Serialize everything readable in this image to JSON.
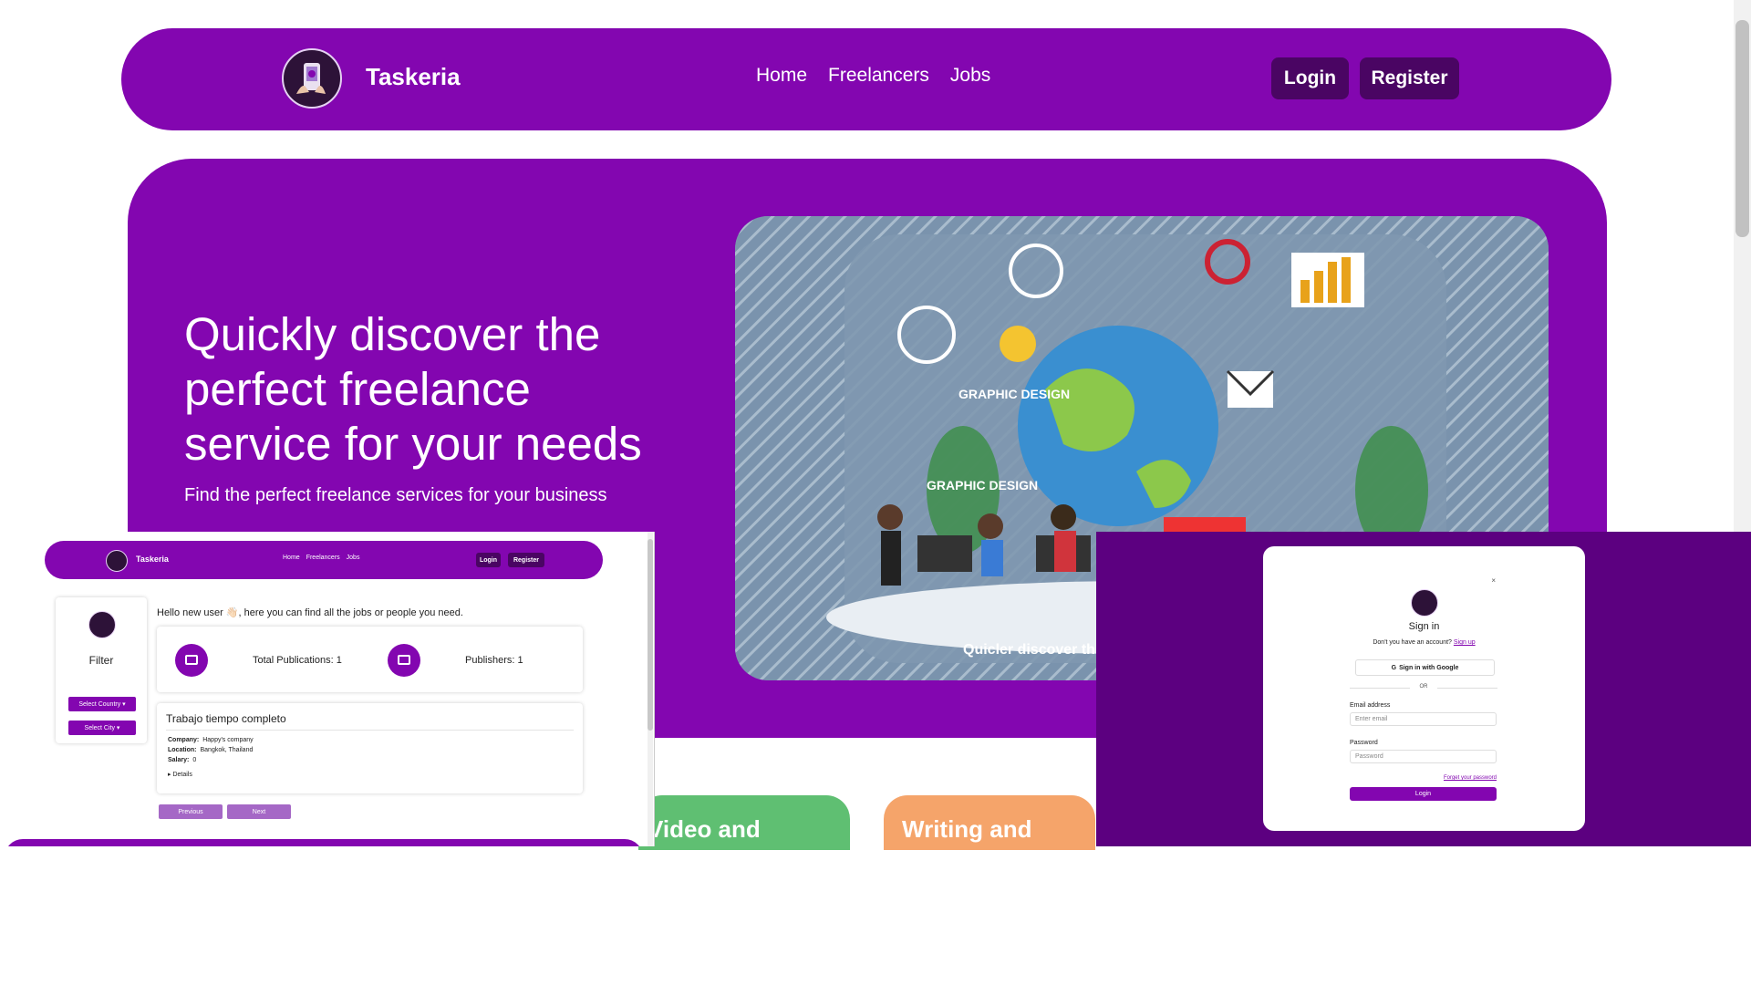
{
  "navbar": {
    "brand": "Taskeria",
    "links": [
      "Home",
      "Freelancers",
      "Jobs"
    ],
    "login": "Login",
    "register": "Register"
  },
  "hero": {
    "title": "Quickly discover the perfect freelance service for your needs",
    "subtitle": "Find the perfect freelance services for your business",
    "image_caption": "Quicler discover th",
    "image_labels": [
      "GRAPHIC DESIGN",
      "GRAPHIC DESIGN"
    ]
  },
  "categories": [
    "Video and",
    "Writing and"
  ],
  "dashboard": {
    "brand": "Taskeria",
    "links": [
      "Home",
      "Freelancers",
      "Jobs"
    ],
    "login": "Login",
    "register": "Register",
    "filter_title": "Filter",
    "select_country": "Select Country ▾",
    "select_city": "Select City ▾",
    "greeting": "Hello new user 👋🏻, here you can find all the jobs or people you need.",
    "total_publications": "Total Publications: 1",
    "publishers": "Publishers: 1",
    "job": {
      "title": "Trabajo tiempo completo",
      "company_label": "Company:",
      "company": "Happy's company",
      "location_label": "Location:",
      "location": "Bangkok, Thailand",
      "salary_label": "Salary:",
      "salary": "0",
      "details": "▸ Details"
    },
    "previous": "Previous",
    "next": "Next"
  },
  "signin": {
    "close": "×",
    "title": "Sign in",
    "no_account": "Don't you have an account?",
    "sign_up": "Sign up",
    "google": "Sign in with Google",
    "or": "OR",
    "email_label": "Email address",
    "email_placeholder": "Enter email",
    "password_label": "Password",
    "password_placeholder": "Password",
    "forgot": "Forget your password",
    "login": "Login"
  },
  "colors": {
    "primary": "#8306b0",
    "dark": "#4a0563",
    "overlay": "#5c0080",
    "green_card": "#5fbf72",
    "orange_card": "#f5a46a"
  }
}
